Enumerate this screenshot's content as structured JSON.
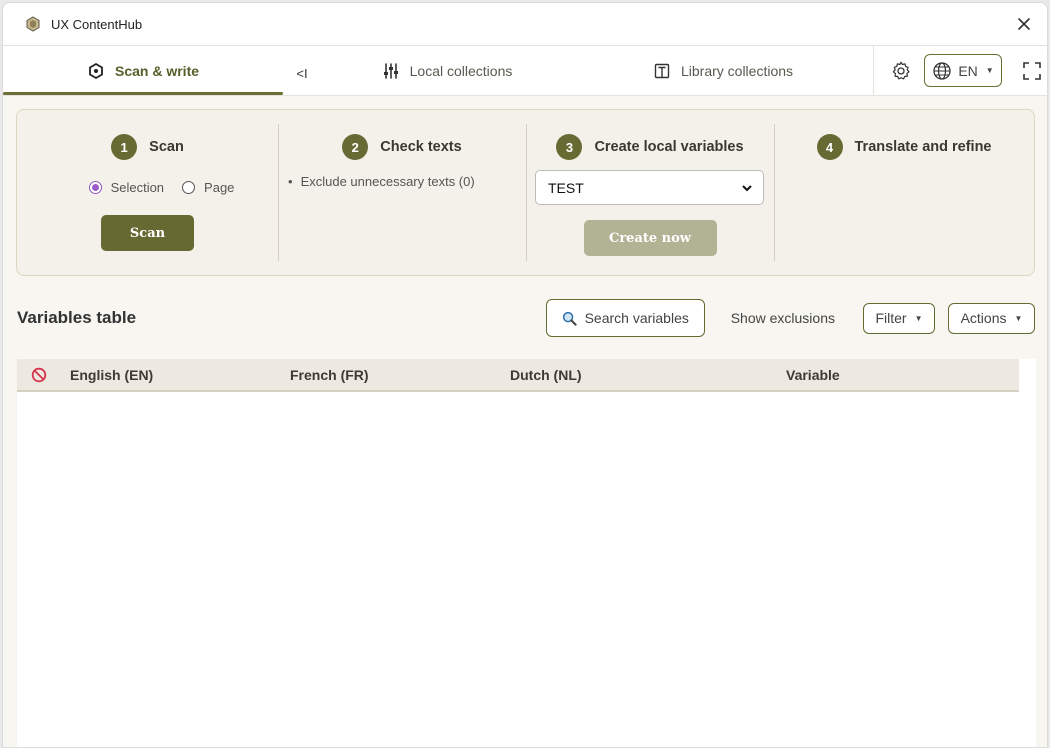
{
  "window": {
    "title": "UX ContentHub"
  },
  "tabs": {
    "scan_write": "Scan & write",
    "collapse": "<I",
    "local_collections": "Local collections",
    "library_collections": "Library collections"
  },
  "toolbar": {
    "language": "EN"
  },
  "steps": {
    "scan": {
      "number": "1",
      "title": "Scan",
      "option_selection": "Selection",
      "option_page": "Page",
      "selected": "Selection",
      "button": "Scan"
    },
    "check": {
      "number": "2",
      "title": "Check texts",
      "item": "Exclude unnecessary texts (0)"
    },
    "create": {
      "number": "3",
      "title": "Create local variables",
      "select_value": "TEST",
      "button": "Create now"
    },
    "translate": {
      "number": "4",
      "title": "Translate and refine"
    }
  },
  "variables": {
    "title": "Variables table",
    "search_label": "Search variables",
    "show_exclusions": "Show exclusions",
    "filter_label": "Filter",
    "actions_label": "Actions",
    "columns": [
      "English (EN)",
      "French (FR)",
      "Dutch (NL)",
      "Variable"
    ],
    "rows": []
  },
  "colors": {
    "accent": "#666a32",
    "accent_disabled": "#b2b394",
    "radio_selected": "#9b5cc8",
    "ban_icon": "#d6334a"
  }
}
